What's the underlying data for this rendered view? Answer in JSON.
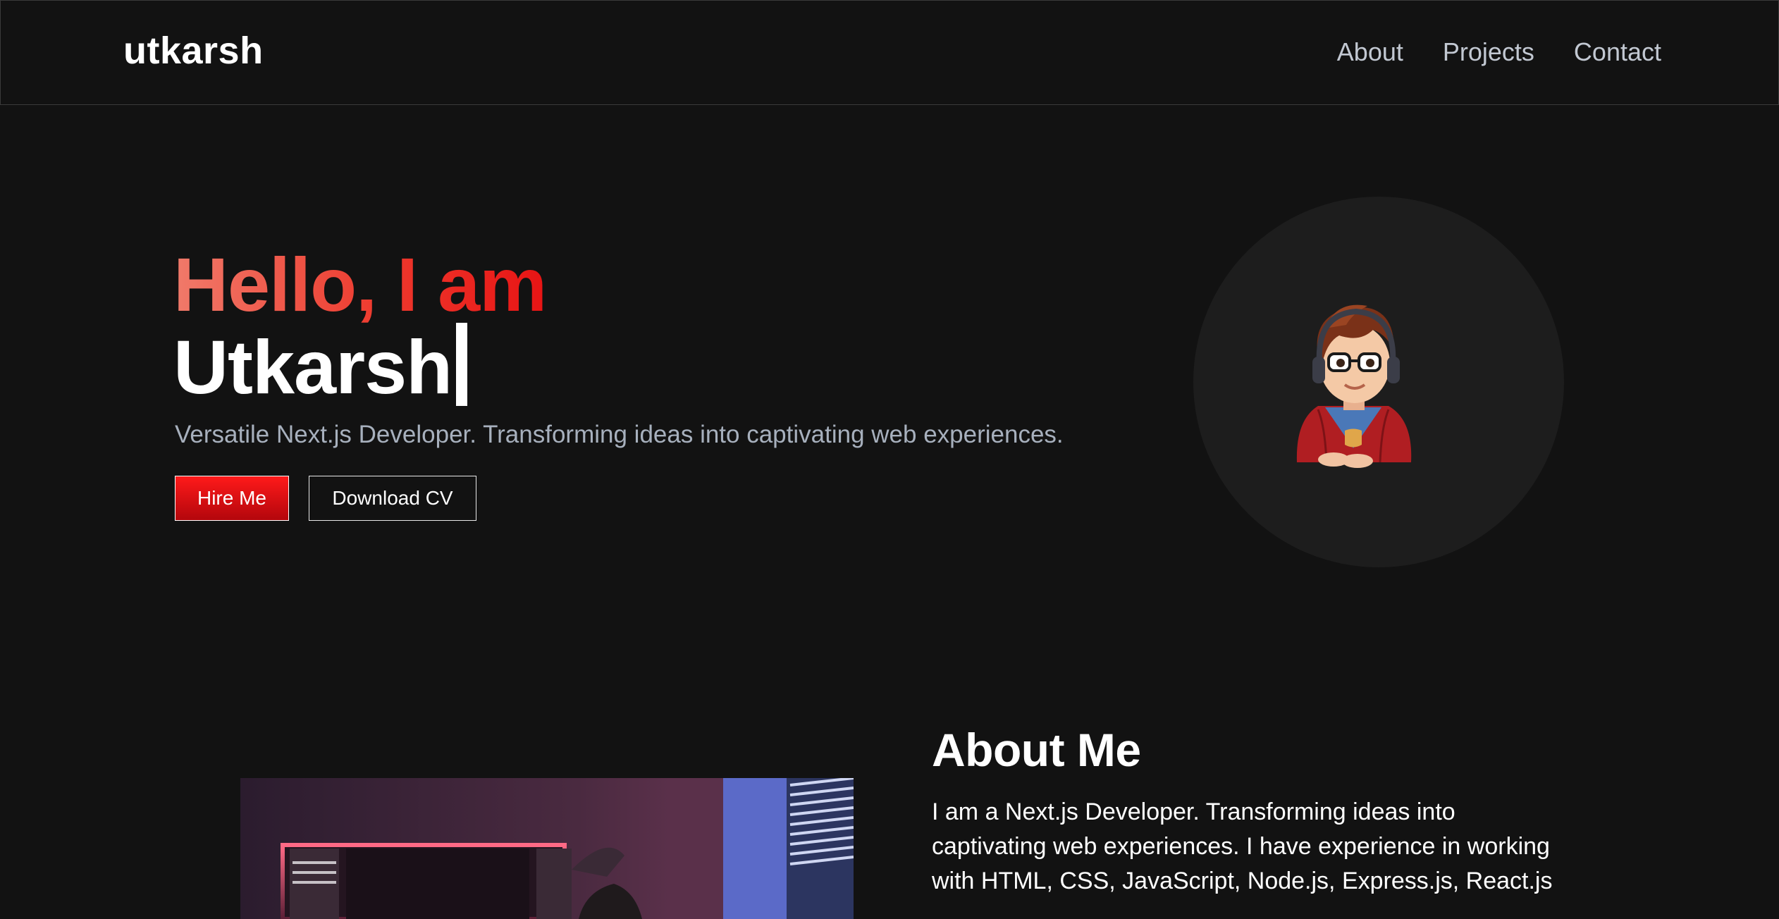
{
  "nav": {
    "brand": "utkarsh",
    "links": [
      "About",
      "Projects",
      "Contact"
    ]
  },
  "hero": {
    "greeting": "Hello, I am",
    "name": "Utkarsh",
    "tagline": "Versatile Next.js Developer. Transforming ideas into captivating web experiences.",
    "buttons": {
      "hire": "Hire Me",
      "cv": "Download CV"
    },
    "avatar_icon": "developer-avatar-icon"
  },
  "about": {
    "title": "About Me",
    "text": "I am a Next.js Developer. Transforming ideas into captivating web experiences. I have experience in working with HTML, CSS, JavaScript, Node.js, Express.js, React.js"
  },
  "colors": {
    "background": "#121212",
    "accent_red": "#e81414",
    "gradient_start": "#f07a6a",
    "muted_text": "#a7b0bd",
    "nav_text": "#c2c8d2",
    "avatar_bg": "#1d1d1d"
  }
}
